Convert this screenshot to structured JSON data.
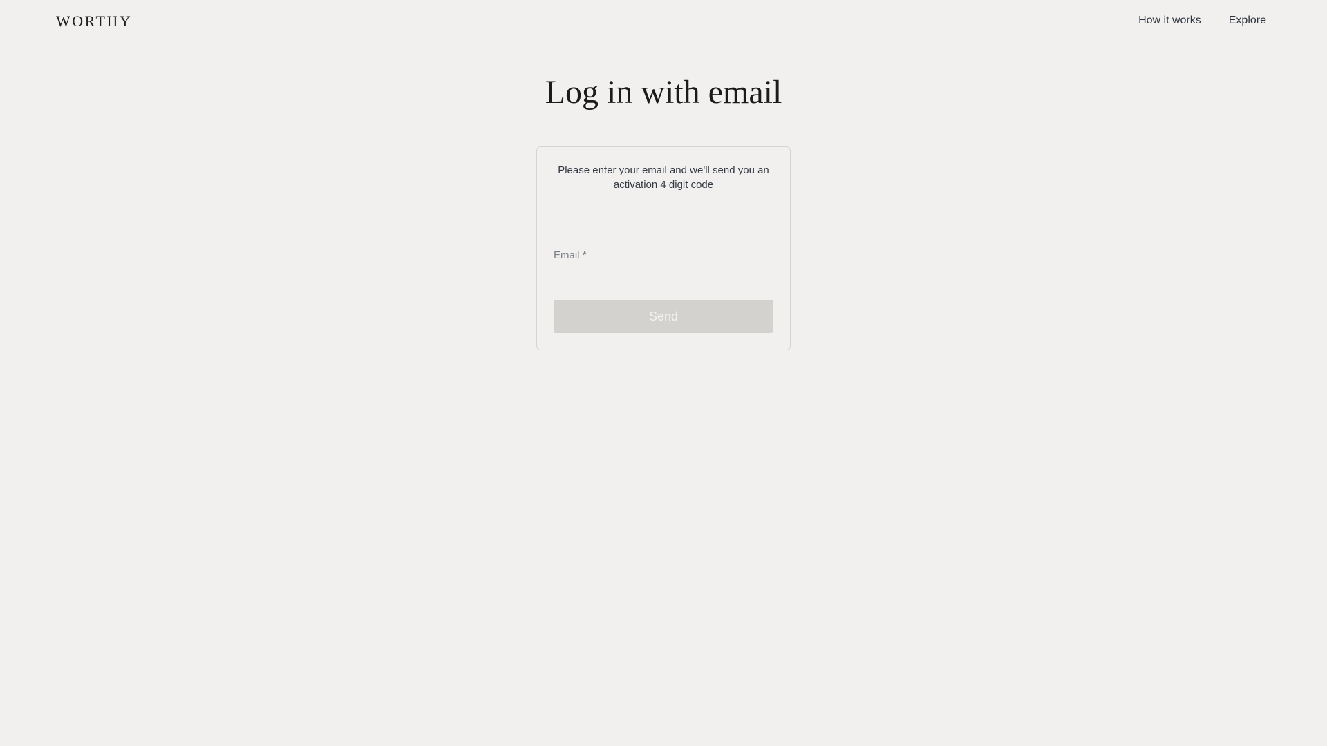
{
  "header": {
    "logo": "WORTHY",
    "nav": [
      {
        "label": "How it works"
      },
      {
        "label": "Explore"
      }
    ]
  },
  "main": {
    "title": "Log in with email",
    "card": {
      "description": "Please enter your email and we'll send you an activation 4 digit code",
      "email_field": {
        "label": "Email *",
        "value": ""
      },
      "send_button": "Send"
    }
  },
  "colors": {
    "background": "#f1f0ee",
    "border": "#d6d4d1",
    "button_disabled_bg": "#d3d2cf",
    "button_disabled_text": "#f4f3f1"
  }
}
